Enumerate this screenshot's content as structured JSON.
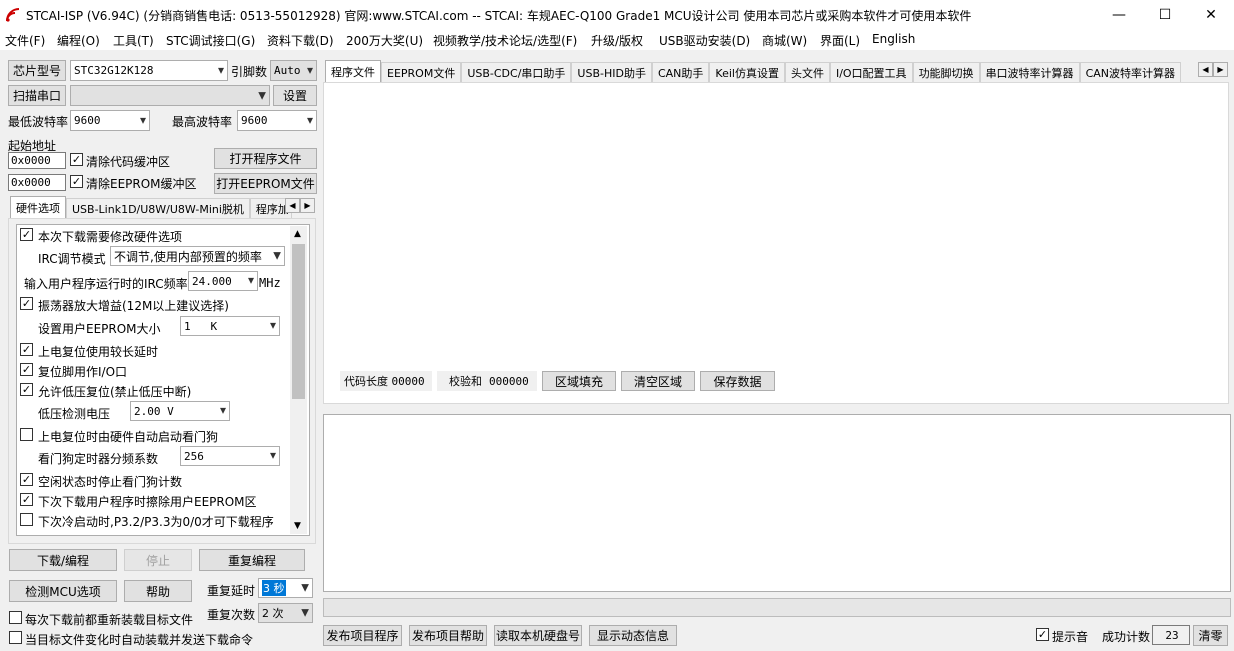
{
  "window": {
    "title": "STCAI-ISP (V6.94C) (分销商销售电话: 0513-55012928) 官网:www.STCAI.com  -- STCAI: 车规AEC-Q100 Grade1 MCU设计公司 使用本司芯片或采购本软件才可使用本软件",
    "minimize": "—",
    "maximize": "☐",
    "close": "✕"
  },
  "menu": [
    "文件(F)",
    "编程(O)",
    "工具(T)",
    "STC调试接口(G)",
    "资料下载(D)",
    "200万大奖(U)",
    "视频教学/技术论坛/选型(F)",
    "升级/版权",
    "USB驱动安装(D)",
    "商城(W)",
    "界面(L)",
    "English"
  ],
  "left": {
    "chip_type_btn": "芯片型号",
    "chip_value": "STC32G12K128",
    "pins_label": "引脚数",
    "pins_value": "Auto",
    "scan_port_btn": "扫描串口",
    "port_value": "",
    "settings_btn": "设置",
    "min_baud_label": "最低波特率",
    "min_baud": "9600",
    "max_baud_label": "最高波特率",
    "max_baud": "9600",
    "start_addr_label": "起始地址",
    "addr1": "0x0000",
    "clear_code": "清除代码缓冲区",
    "open_prog": "打开程序文件",
    "addr2": "0x0000",
    "clear_eeprom": "清除EEPROM缓冲区",
    "open_eeprom": "打开EEPROM文件",
    "subtabs": [
      "硬件选项",
      "USB-Link1D/U8W/U8W-Mini脱机",
      "程序加"
    ],
    "hw": {
      "r1": "本次下载需要修改硬件选项",
      "irc_label": "IRC调节模式",
      "irc_value": "不调节,使用内部预置的频率",
      "freq_label": "输入用户程序运行时的IRC频率",
      "freq_value": "24.000",
      "freq_unit": "MHz",
      "r_osc": "振荡器放大增益(12M以上建议选择)",
      "eeprom_label": "设置用户EEPROM大小",
      "eeprom_value": "1   K",
      "r_delay": "上电复位使用较长延时",
      "r_reset": "复位脚用作I/O口",
      "r_lvr": "允许低压复位(禁止低压中断)",
      "lvd_label": "低压检测电压",
      "lvd_value": "2.00 V",
      "r_wdt": "上电复位时由硬件自动启动看门狗",
      "wdt_div_label": "看门狗定时器分频系数",
      "wdt_div_value": "256",
      "r_idle": "空闲状态时停止看门狗计数",
      "r_erase": "下次下载用户程序时擦除用户EEPROM区",
      "r_p32": "下次冷启动时,P3.2/P3.3为0/0才可下载程序"
    },
    "download_btn": "下载/编程",
    "stop_btn": "停止",
    "reprog_btn": "重复编程",
    "detect_btn": "检测MCU选项",
    "help_btn": "帮助",
    "repeat_delay_label": "重复延时",
    "repeat_delay": "3 秒",
    "repeat_count_label": "重复次数",
    "repeat_count": "2 次",
    "reload_each": "每次下载前都重新装载目标文件",
    "auto_reload": "当目标文件变化时自动装载并发送下载命令"
  },
  "right": {
    "tabs": [
      "程序文件",
      "EEPROM文件",
      "USB-CDC/串口助手",
      "USB-HID助手",
      "CAN助手",
      "Keil仿真设置",
      "头文件",
      "I/O口配置工具",
      "功能脚切换",
      "串口波特率计算器",
      "CAN波特率计算器"
    ],
    "code_len_label": "代码长度",
    "code_len": "00000",
    "checksum_label": "校验和",
    "checksum": "000000",
    "fill_btn": "区域填充",
    "clear_btn": "清空区域",
    "save_btn": "保存数据",
    "publish_prog": "发布项目程序",
    "publish_help": "发布项目帮助",
    "read_disk": "读取本机硬盘号",
    "show_dyn": "显示动态信息",
    "beep": "提示音",
    "success_label": "成功计数",
    "success_count": "23",
    "clear_count": "清零"
  }
}
